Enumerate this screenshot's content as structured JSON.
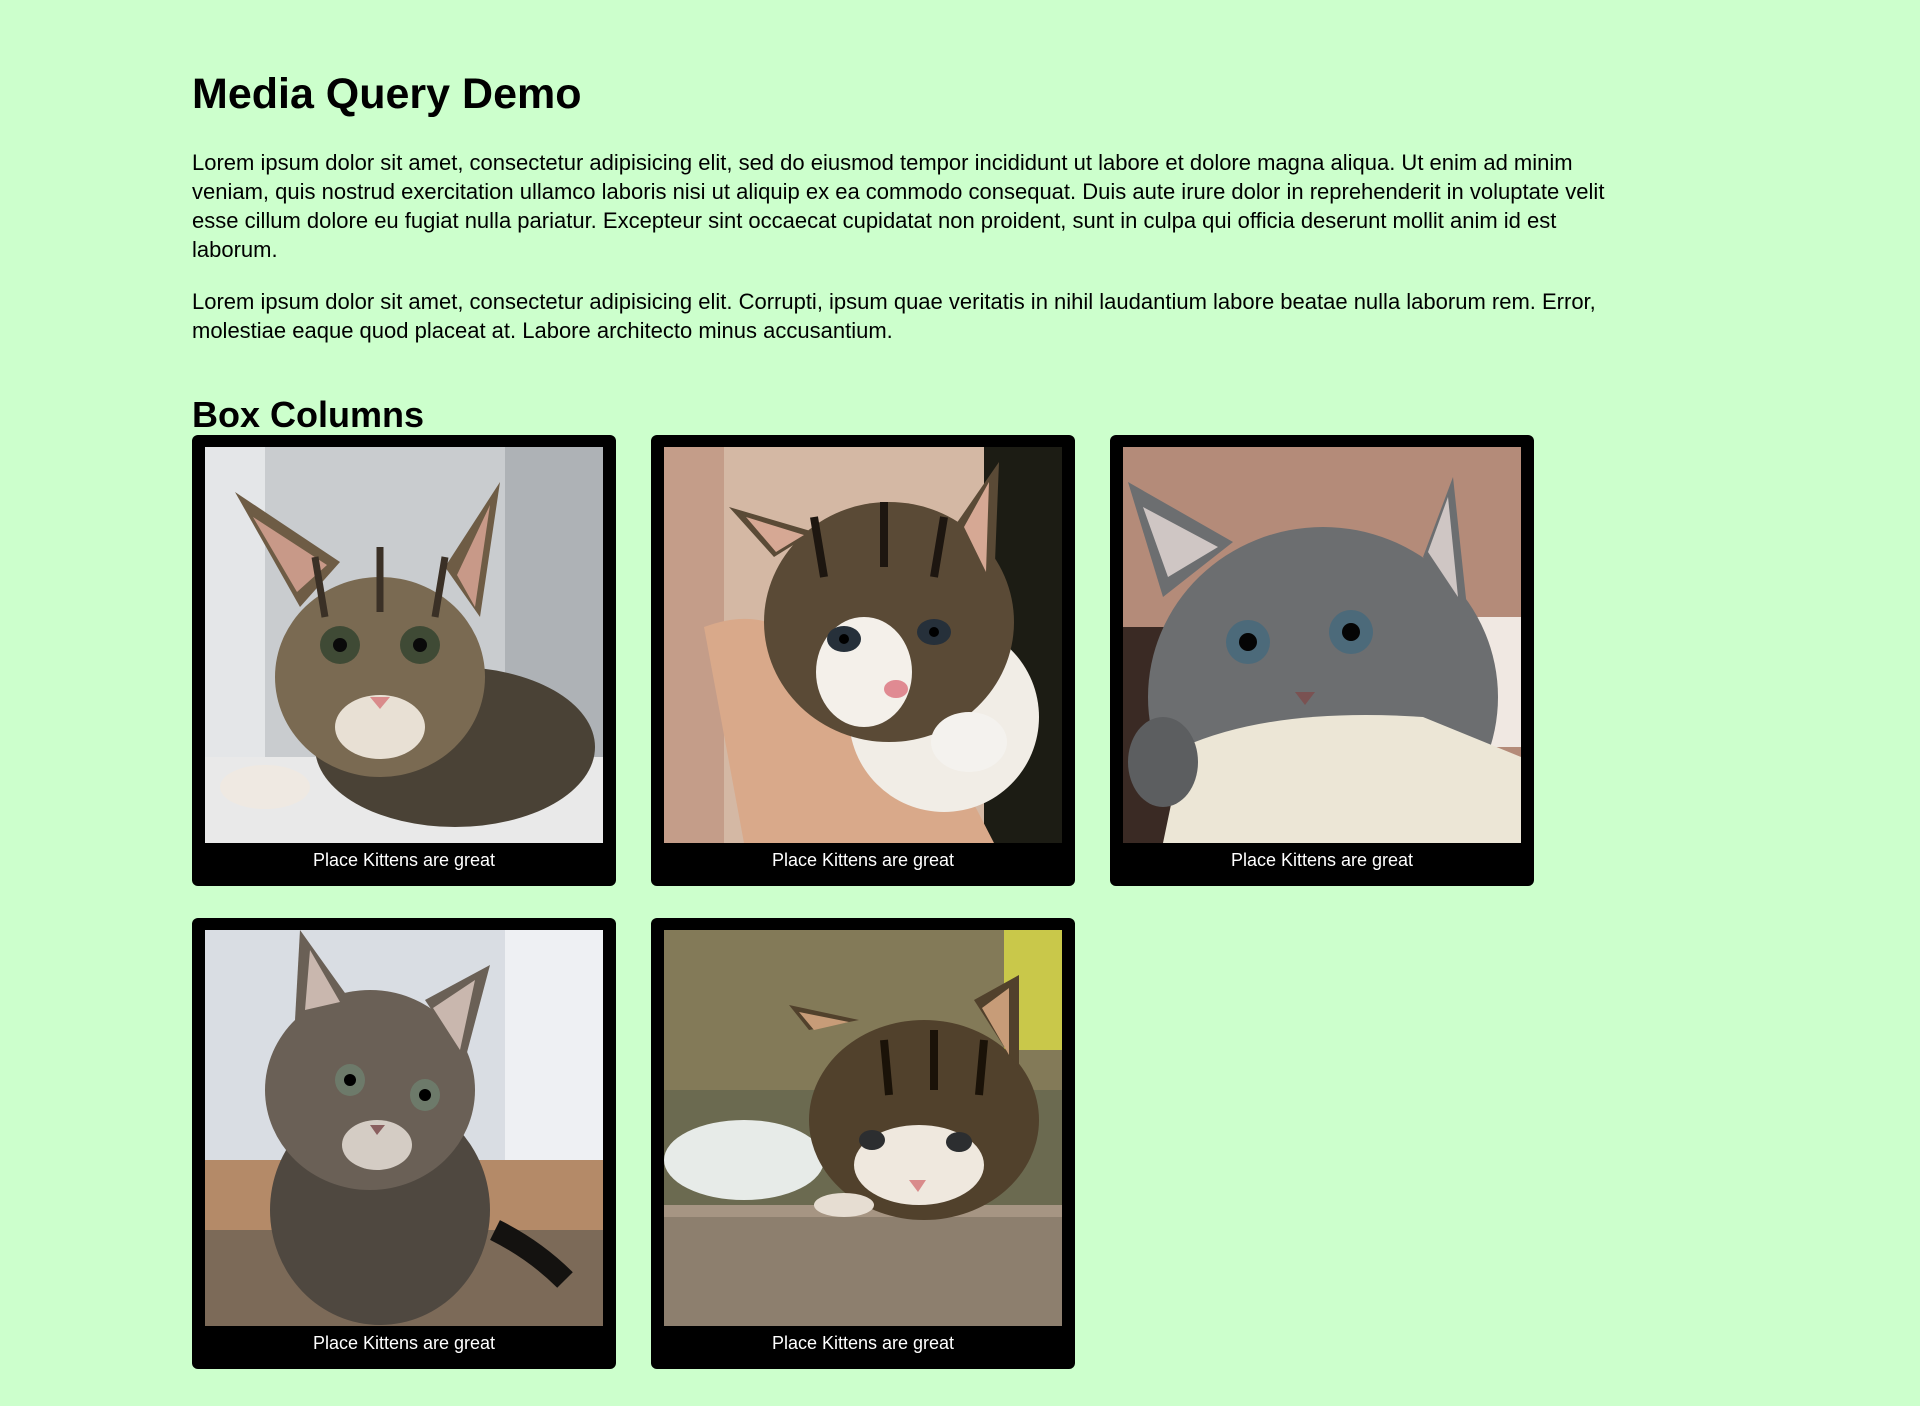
{
  "page": {
    "title": "Media Query Demo",
    "paragraphs": [
      "Lorem ipsum dolor sit amet, consectetur adipisicing elit, sed do eiusmod tempor incididunt ut labore et dolore magna aliqua. Ut enim ad minim veniam, quis nostrud exercitation ullamco laboris nisi ut aliquip ex ea commodo consequat. Duis aute irure dolor in reprehenderit in voluptate velit esse cillum dolore eu fugiat nulla pariatur. Excepteur sint occaecat cupidatat non proident, sunt in culpa qui officia deserunt mollit anim id est laborum.",
      "Lorem ipsum dolor sit amet, consectetur adipisicing elit. Corrupti, ipsum quae veritatis in nihil laudantium labore beatae nulla laborum rem. Error, molestiae eaque quod placeat at. Labore architecto minus accusantium."
    ],
    "section_title": "Box Columns"
  },
  "cards": [
    {
      "caption": "Place Kittens are great"
    },
    {
      "caption": "Place Kittens are great"
    },
    {
      "caption": "Place Kittens are great"
    },
    {
      "caption": "Place Kittens are great"
    },
    {
      "caption": "Place Kittens are great"
    }
  ],
  "colors": {
    "page_background": "#ccffcc",
    "card_background": "#000000",
    "caption_text": "#ffffff"
  }
}
